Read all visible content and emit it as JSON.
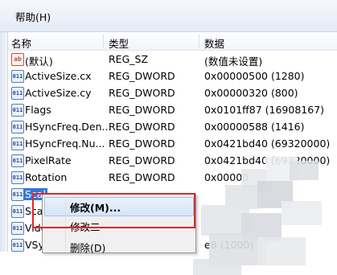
{
  "menubar": {
    "help_label": "帮助(H)"
  },
  "columns": {
    "name": "名称",
    "type": "类型",
    "data": "数据"
  },
  "rows": [
    {
      "icon": "ab",
      "name": "(默认)",
      "type": "REG_SZ",
      "data": "(数值未设置)"
    },
    {
      "icon": "bin",
      "name": "ActiveSize.cx",
      "type": "REG_DWORD",
      "data": "0x00000500 (1280)"
    },
    {
      "icon": "bin",
      "name": "ActiveSize.cy",
      "type": "REG_DWORD",
      "data": "0x00000320 (800)"
    },
    {
      "icon": "bin",
      "name": "Flags",
      "type": "REG_DWORD",
      "data": "0x0101ff87 (16908167)"
    },
    {
      "icon": "bin",
      "name": "HSyncFreq.Den...",
      "type": "REG_DWORD",
      "data": "0x00000588 (1416)"
    },
    {
      "icon": "bin",
      "name": "HSyncFreq.Nu...",
      "type": "REG_DWORD",
      "data": "0x0421bd40 (69320000)"
    },
    {
      "icon": "bin",
      "name": "PixelRate",
      "type": "REG_DWORD",
      "data": "0x0421bd40 (69320000)"
    },
    {
      "icon": "bin",
      "name": "Rotation",
      "type": "REG_DWORD",
      "data": "0x00000"
    },
    {
      "icon": "bin",
      "name": "Scal",
      "type": "",
      "data": ""
    },
    {
      "icon": "bin",
      "name": "Sca",
      "type": "",
      "data": ""
    },
    {
      "icon": "bin",
      "name": "Vide",
      "type": "",
      "data": ""
    },
    {
      "icon": "bin",
      "name": "VSy",
      "type": "",
      "data": "e8 (1000)"
    }
  ],
  "context_menu": {
    "items": [
      {
        "label": "修改(M)...",
        "bold": true
      },
      {
        "label": "修改二",
        "bold": false
      },
      {
        "label": "删除(D)",
        "bold": false
      }
    ]
  },
  "colors": {
    "selection": "#3875d7",
    "highlight_box": "#e02828"
  }
}
